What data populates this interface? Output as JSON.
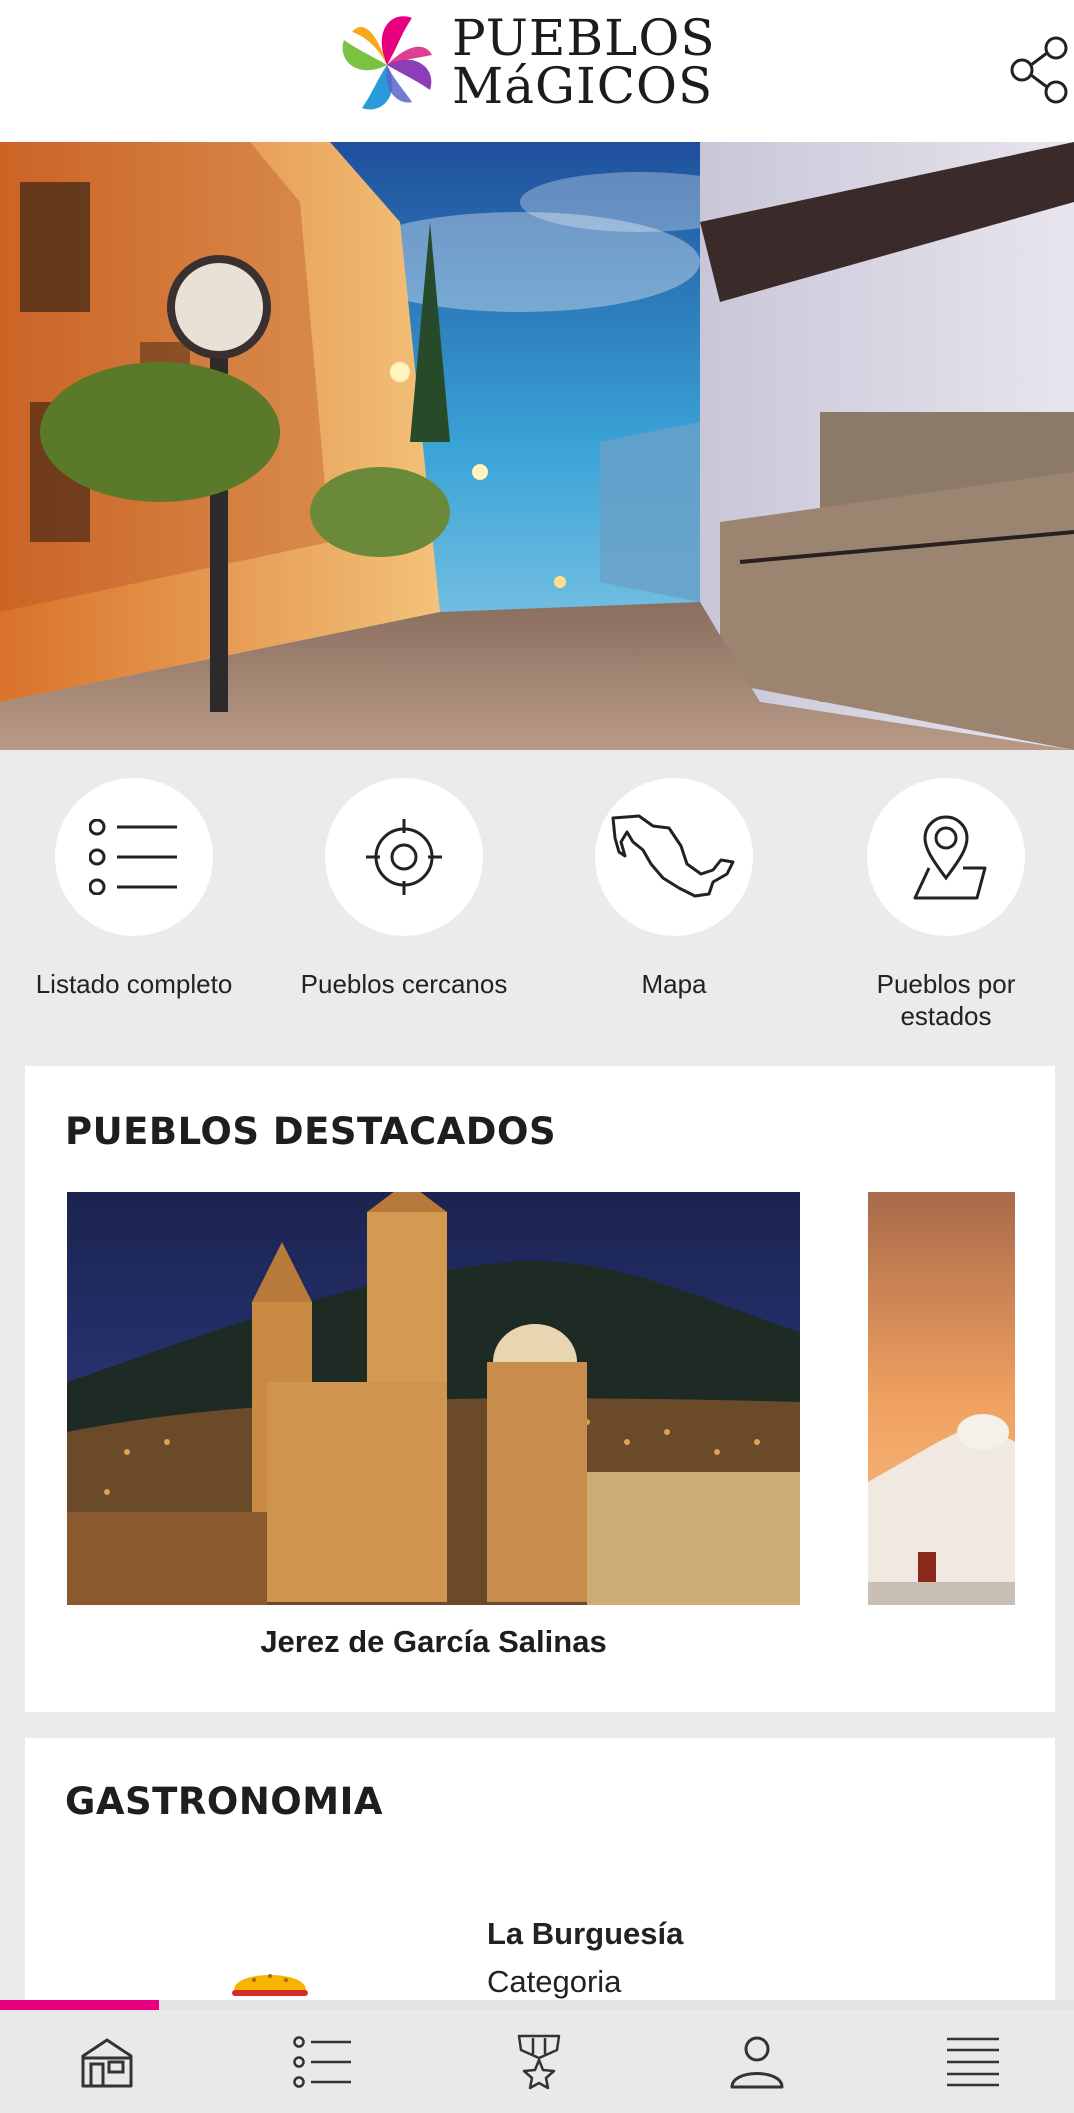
{
  "header": {
    "logo_line1": "PUEBLOS",
    "logo_line2": "MáGICOS",
    "logo_colors": [
      "#e6007e",
      "#8a3fb8",
      "#2a9bd8",
      "#7cc242",
      "#f7a81b"
    ]
  },
  "actions": [
    {
      "label": "Listado completo",
      "icon": "list-icon"
    },
    {
      "label": "Pueblos cercanos",
      "icon": "target-icon"
    },
    {
      "label": "Mapa",
      "icon": "mexico-map-icon"
    },
    {
      "label": "Pueblos por estados",
      "icon": "location-pin-icon"
    }
  ],
  "featured": {
    "title": "PUEBLOS DESTACADOS",
    "items": [
      {
        "name": "Jerez de García Salinas"
      }
    ]
  },
  "gastronomia": {
    "title": "GASTRONOMIA",
    "item": {
      "name": "La Burguesía",
      "category": "Categoria"
    }
  },
  "progress": 0.2,
  "bottom_nav": [
    {
      "icon": "home-icon"
    },
    {
      "icon": "list-icon"
    },
    {
      "icon": "medal-icon"
    },
    {
      "icon": "user-icon"
    },
    {
      "icon": "menu-icon"
    }
  ],
  "colors": {
    "accent": "#e6007e",
    "background": "#ebebeb"
  }
}
